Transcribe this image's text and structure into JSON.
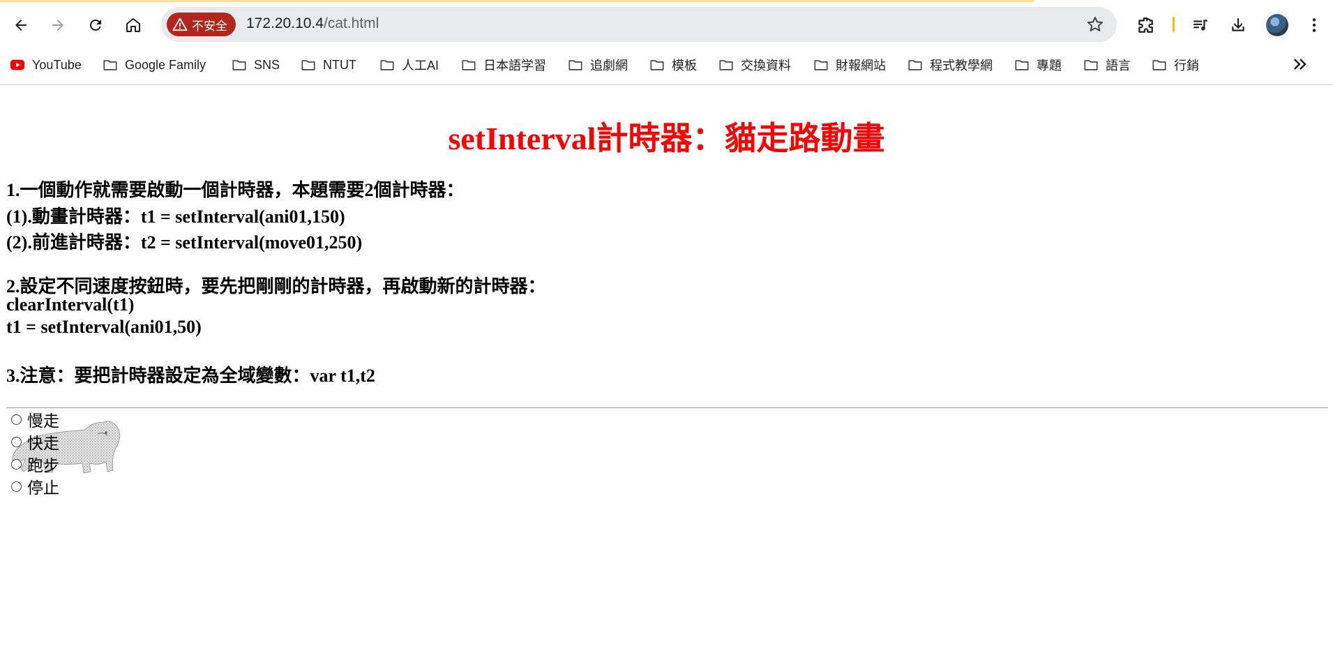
{
  "browser": {
    "security_label": "不安全",
    "url_host": "172.20.10.4",
    "url_path": "/cat.html",
    "bookmarks": [
      {
        "label": "YouTube",
        "icon": "youtube-icon"
      },
      {
        "label": "Google Family",
        "icon": "folder-icon"
      },
      {
        "label": "SNS",
        "icon": "folder-icon"
      },
      {
        "label": "NTUT",
        "icon": "folder-icon"
      },
      {
        "label": "人工AI",
        "icon": "folder-icon"
      },
      {
        "label": "日本語学習",
        "icon": "folder-icon"
      },
      {
        "label": "追劇網",
        "icon": "folder-icon"
      },
      {
        "label": "模板",
        "icon": "folder-icon"
      },
      {
        "label": "交換資料",
        "icon": "folder-icon"
      },
      {
        "label": "財報網站",
        "icon": "folder-icon"
      },
      {
        "label": "程式教學網",
        "icon": "folder-icon"
      },
      {
        "label": "專題",
        "icon": "folder-icon"
      },
      {
        "label": "語言",
        "icon": "folder-icon"
      },
      {
        "label": "行銷",
        "icon": "folder-icon"
      }
    ],
    "colors": {
      "insecure_chip": "#b3261e",
      "loading_bar": "#fde293"
    }
  },
  "page": {
    "title": "setInterval計時器：貓走路動畫",
    "notes": [
      "1.一個動作就需要啟動一個計時器，本題需要2個計時器：",
      "(1).動畫計時器：t1 = setInterval(ani01,150)",
      "(2).前進計時器：t2 = setInterval(move01,250)",
      "2.設定不同速度按鈕時，要先把剛剛的計時器，再啟動新的計時器：",
      "clearInterval(t1)",
      "t1 = setInterval(ani01,50)",
      "3.注意：要把計時器設定為全域變數：var t1,t2"
    ],
    "speed_options": [
      "慢走",
      "快走",
      "跑步",
      "停止"
    ],
    "title_color": "#ff0000"
  }
}
